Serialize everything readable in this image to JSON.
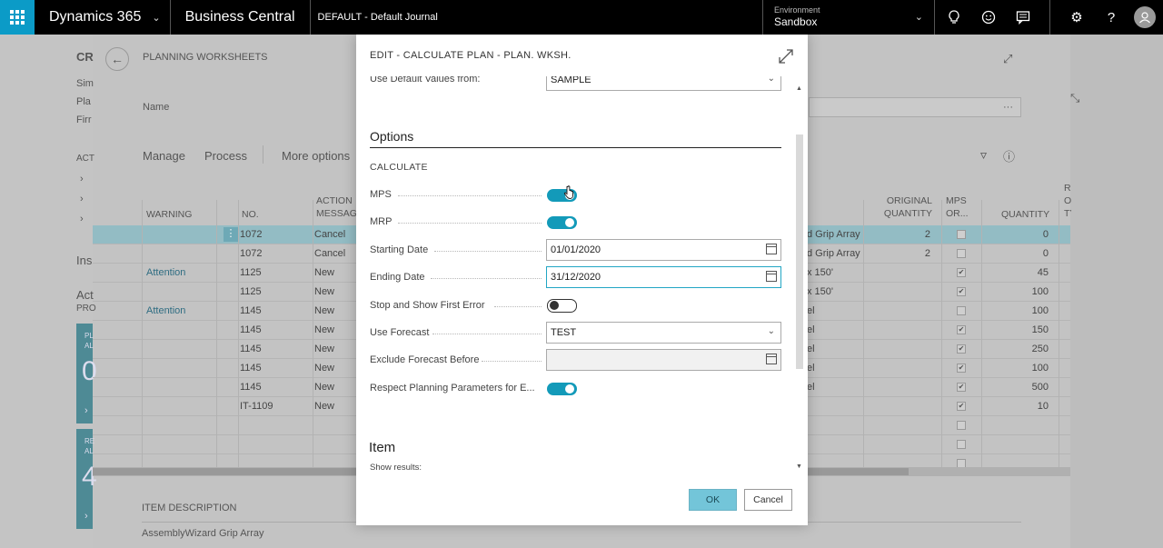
{
  "topbar": {
    "app_name": "Dynamics 365",
    "product": "Business Central",
    "company": "DEFAULT - Default Journal",
    "environment_label": "Environment",
    "environment_value": "Sandbox"
  },
  "background": {
    "page_letters": "CR",
    "left_labels": [
      "Sim",
      "Pla",
      "Firr",
      "ACT",
      "Ins",
      "Act",
      "PRO"
    ],
    "tile_letters": [
      "PL",
      "AL",
      "RE",
      "AL"
    ],
    "tile_digits": [
      "0",
      "4"
    ],
    "breadcrumb": "PLANNING WORKSHEETS",
    "name_label": "Name",
    "search_ellipsis": "···",
    "actions": [
      "Manage",
      "Process",
      "More options"
    ],
    "columns": [
      "WARNING",
      "NO.",
      "ACTION MESSAG",
      "ORIGINAL QUANTITY",
      "MPS OR...",
      "QUANTITY",
      "R O TY"
    ],
    "rows": [
      {
        "warning": "",
        "no": "1072",
        "action": "Cancel",
        "desc": "d Grip Array",
        "orig": "2",
        "mps": false,
        "qty": "0",
        "selected": true
      },
      {
        "warning": "",
        "no": "1072",
        "action": "Cancel",
        "desc": "d Grip Array",
        "orig": "2",
        "mps": false,
        "qty": "0",
        "selected": false
      },
      {
        "warning": "Attention",
        "no": "1125",
        "action": "New",
        "desc": "x 150'",
        "orig": "",
        "mps": true,
        "qty": "45",
        "selected": false
      },
      {
        "warning": "",
        "no": "1125",
        "action": "New",
        "desc": "x 150'",
        "orig": "",
        "mps": true,
        "qty": "100",
        "selected": false
      },
      {
        "warning": "Attention",
        "no": "1145",
        "action": "New",
        "desc": "el",
        "orig": "",
        "mps": false,
        "qty": "100",
        "selected": false
      },
      {
        "warning": "",
        "no": "1145",
        "action": "New",
        "desc": "el",
        "orig": "",
        "mps": true,
        "qty": "150",
        "selected": false
      },
      {
        "warning": "",
        "no": "1145",
        "action": "New",
        "desc": "el",
        "orig": "",
        "mps": true,
        "qty": "250",
        "selected": false
      },
      {
        "warning": "",
        "no": "1145",
        "action": "New",
        "desc": "el",
        "orig": "",
        "mps": true,
        "qty": "100",
        "selected": false
      },
      {
        "warning": "",
        "no": "1145",
        "action": "New",
        "desc": "el",
        "orig": "",
        "mps": true,
        "qty": "500",
        "selected": false
      },
      {
        "warning": "",
        "no": "IT-1109",
        "action": "New",
        "desc": "",
        "orig": "",
        "mps": true,
        "qty": "10",
        "selected": false
      },
      {
        "warning": "",
        "no": "",
        "action": "",
        "desc": "",
        "orig": "",
        "mps": false,
        "qty": "",
        "selected": false
      },
      {
        "warning": "",
        "no": "",
        "action": "",
        "desc": "",
        "orig": "",
        "mps": false,
        "qty": "",
        "selected": false
      },
      {
        "warning": "",
        "no": "",
        "action": "",
        "desc": "",
        "orig": "",
        "mps": false,
        "qty": "",
        "selected": false
      }
    ],
    "factbox_label": "ITEM DESCRIPTION",
    "factbox_value": "AssemblyWizard Grip Array"
  },
  "dialog": {
    "title": "EDIT - CALCULATE PLAN - PLAN. WKSH.",
    "top_field_label": "Use Default Values from:",
    "top_field_value": "SAMPLE",
    "options_heading": "Options",
    "calculate_sub": "CALCULATE",
    "fields": {
      "mps": {
        "label": "MPS",
        "on": true
      },
      "mrp": {
        "label": "MRP",
        "on": true
      },
      "starting_date": {
        "label": "Starting Date",
        "value": "01/01/2020"
      },
      "ending_date": {
        "label": "Ending Date",
        "value": "31/12/2020"
      },
      "stop_first_error": {
        "label": "Stop and Show First Error",
        "on": false
      },
      "use_forecast": {
        "label": "Use Forecast",
        "value": "TEST"
      },
      "exclude_forecast": {
        "label": "Exclude Forecast Before",
        "value": ""
      },
      "respect_params": {
        "label": "Respect Planning Parameters for E...",
        "on": true
      }
    },
    "item_heading": "Item",
    "show_results": "Show results:",
    "ok_label": "OK",
    "cancel_label": "Cancel"
  }
}
